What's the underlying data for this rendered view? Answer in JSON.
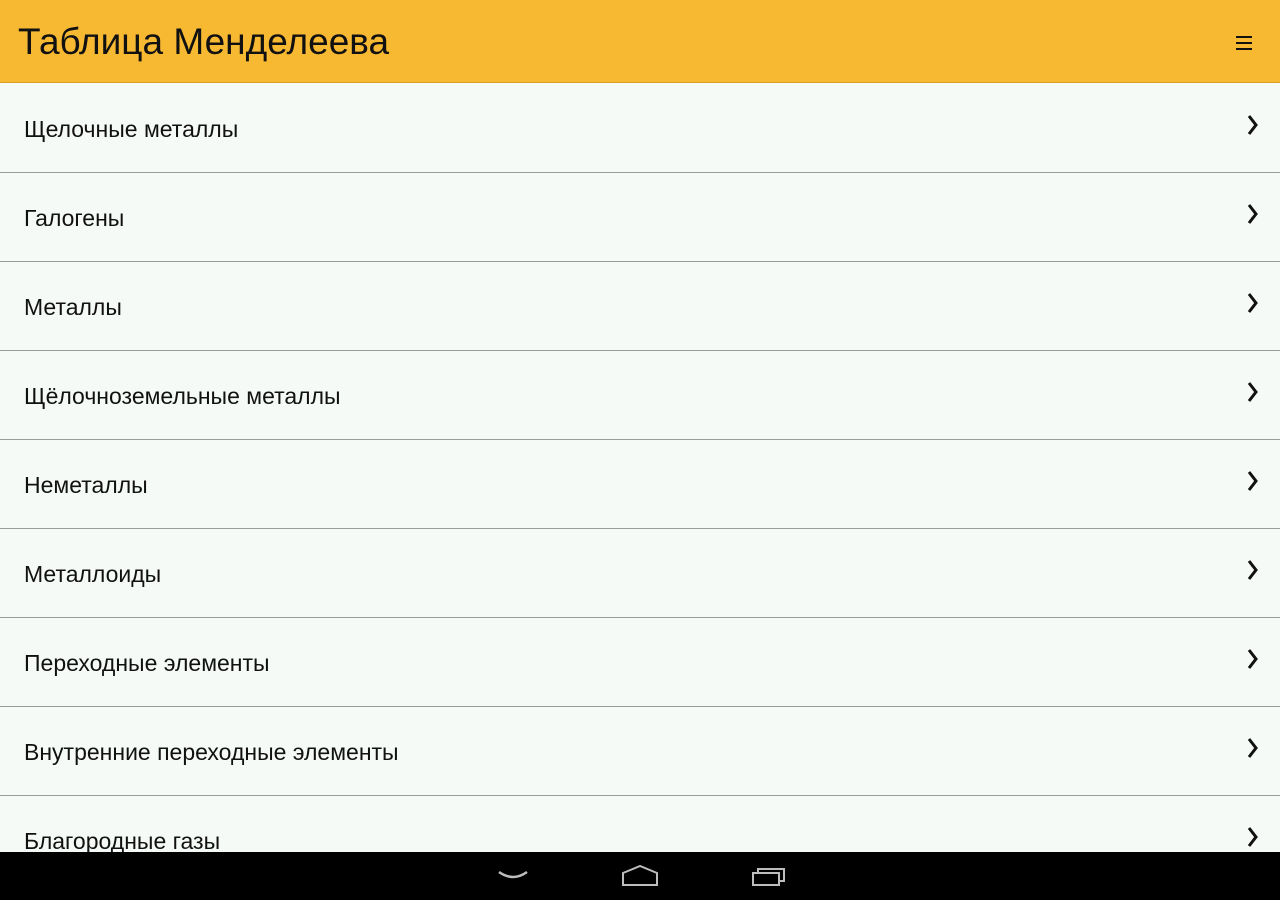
{
  "app_bar": {
    "title": "Таблица Менделеева",
    "menu_icon": "hamburger-menu-icon",
    "background_color": "#f8b932"
  },
  "categories": [
    {
      "label": "Щелочные металлы",
      "icon": "chevron-right-icon"
    },
    {
      "label": "Галогены",
      "icon": "chevron-right-icon"
    },
    {
      "label": "Металлы",
      "icon": "chevron-right-icon"
    },
    {
      "label": "Щёлочноземельные металлы",
      "icon": "chevron-right-icon"
    },
    {
      "label": "Неметаллы",
      "icon": "chevron-right-icon"
    },
    {
      "label": "Металлоиды",
      "icon": "chevron-right-icon"
    },
    {
      "label": "Переходные элементы",
      "icon": "chevron-right-icon"
    },
    {
      "label": "Внутренние переходные элементы",
      "icon": "chevron-right-icon"
    },
    {
      "label": "Благородные газы",
      "icon": "chevron-right-icon"
    }
  ],
  "system_nav": {
    "buttons": [
      "back-icon",
      "home-icon",
      "recent-apps-icon"
    ]
  }
}
